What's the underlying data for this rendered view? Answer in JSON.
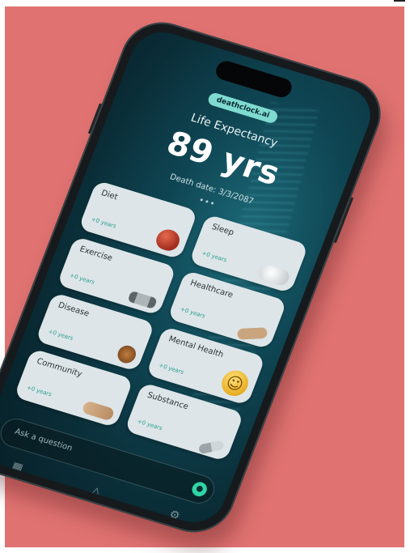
{
  "app": {
    "brand": "deathclock.ai",
    "title": "Life Expectancy",
    "years": "89 yrs",
    "death_date": "Death date: 3/3/2087",
    "ask_placeholder": "Ask a question"
  },
  "cards": [
    {
      "name": "Diet",
      "sub": "+0 years",
      "icon": "apple-icon"
    },
    {
      "name": "Sleep",
      "sub": "+0 years",
      "icon": "pillow-icon"
    },
    {
      "name": "Exercise",
      "sub": "+0 years",
      "icon": "dumbbell-icon"
    },
    {
      "name": "Healthcare",
      "sub": "+0 years",
      "icon": "bandage-icon"
    },
    {
      "name": "Disease",
      "sub": "+0 years",
      "icon": "virus-icon"
    },
    {
      "name": "Mental Health",
      "sub": "+0 years",
      "icon": "smiley-icon"
    },
    {
      "name": "Community",
      "sub": "+0 years",
      "icon": "hands-icon"
    },
    {
      "name": "Substance",
      "sub": "+0 years",
      "icon": "pill-icon"
    }
  ],
  "tabs": [
    {
      "icon": "grid-icon",
      "glyph": "▦"
    },
    {
      "icon": "triangle-icon",
      "glyph": "△"
    },
    {
      "icon": "settings-icon",
      "glyph": "⚙"
    }
  ],
  "colors": {
    "background": "#e07372",
    "accent": "#7fdad0",
    "send": "#2fd5a5",
    "card": "#dde5e8"
  }
}
